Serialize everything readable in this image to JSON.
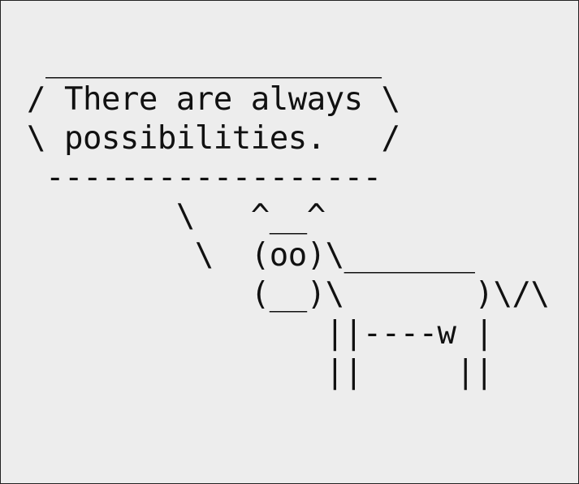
{
  "terminal": {
    "background_color": "#ededed",
    "text_color": "#111111",
    "border_color": "#222222"
  },
  "cowsay": {
    "lines": [
      " __________________",
      "/ There are always \\",
      "\\ possibilities.   /",
      " ------------------",
      "        \\   ^__^",
      "         \\  (oo)\\_______",
      "            (__)\\       )\\/\\",
      "                ||----w |",
      "                ||     ||"
    ]
  }
}
